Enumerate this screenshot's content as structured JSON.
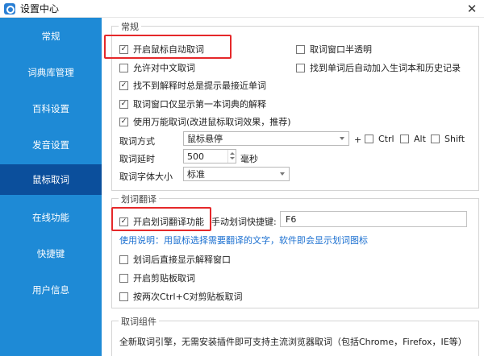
{
  "window": {
    "title": "设置中心",
    "close": "✕"
  },
  "sidebar": {
    "items": [
      {
        "label": "常规"
      },
      {
        "label": "词典库管理"
      },
      {
        "label": "百科设置"
      },
      {
        "label": "发音设置"
      },
      {
        "label": "鼠标取词",
        "active": true
      },
      {
        "label": "在线功能"
      },
      {
        "label": "快捷键"
      },
      {
        "label": "用户信息"
      }
    ]
  },
  "general": {
    "title": "常规",
    "auto_lookup": {
      "label": "开启鼠标自动取词",
      "checked": true
    },
    "translucent": {
      "label": "取词窗口半透明",
      "checked": false
    },
    "allow_chinese": {
      "label": "允许对中文取词",
      "checked": false
    },
    "add_to_history": {
      "label": "找到单词后自动加入生词本和历史记录",
      "checked": false
    },
    "nearest_word": {
      "label": "找不到解释时总是提示最接近单词",
      "checked": true
    },
    "first_dict_only": {
      "label": "取词窗口仅显示第一本词典的解释",
      "checked": true
    },
    "universal_lookup": {
      "label": "使用万能取词(改进鼠标取词效果，推荐)",
      "checked": true
    },
    "method_label": "取词方式",
    "method_value": "鼠标悬停",
    "plus": "+",
    "ctrl": {
      "label": "Ctrl",
      "checked": false
    },
    "alt": {
      "label": "Alt",
      "checked": false
    },
    "shift": {
      "label": "Shift",
      "checked": false
    },
    "delay_label": "取词延时",
    "delay_value": "500",
    "delay_unit": "毫秒",
    "font_label": "取词字体大小",
    "font_value": "标准"
  },
  "translate": {
    "title": "划词翻译",
    "enable": {
      "label": "开启划词翻译功能",
      "checked": true
    },
    "hotkey_label": "手动划词快捷键:",
    "hotkey_value": "F6",
    "usage": "使用说明：用鼠标选择需要翻译的文字，软件即会显示划词图标",
    "show_after": {
      "label": "划词后直接显示解释窗口",
      "checked": false
    },
    "clipboard": {
      "label": "开启剪贴板取词",
      "checked": false
    },
    "ctrl_c_twice": {
      "label": "按两次Ctrl+C对剪贴板取词",
      "checked": false
    }
  },
  "component": {
    "title": "取词组件",
    "text": "全新取词引擎，无需安装插件即可支持主流浏览器取词（包括Chrome，Firefox，IE等）"
  },
  "colors": {
    "sidebar": "#1e8ad6",
    "sidebar_active": "#0b4f9c",
    "highlight": "#e5282a",
    "hint": "#1a6fd0"
  }
}
